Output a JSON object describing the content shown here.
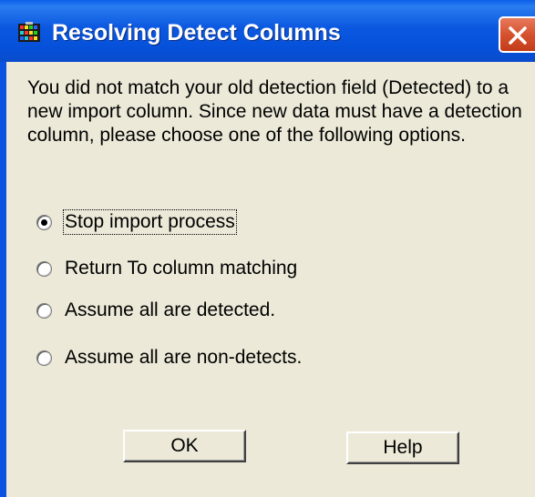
{
  "window": {
    "title": "Resolving Detect Columns",
    "icon": "grid-app-icon",
    "accent": "#0a53e0"
  },
  "message": "You did not match your old detection field (Detected) to a\nnew import column. Since new data must have a detection\ncolumn, please choose one of the following options.",
  "options": [
    {
      "label": "Stop import process",
      "checked": true
    },
    {
      "label": "Return To column matching",
      "checked": false
    },
    {
      "label": "Assume all are detected.",
      "checked": false
    },
    {
      "label": "Assume all are non-detects.",
      "checked": false
    }
  ],
  "buttons": {
    "ok": "OK",
    "help": "Help"
  }
}
